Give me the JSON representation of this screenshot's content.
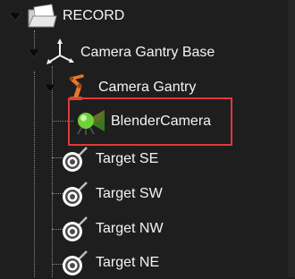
{
  "tree": {
    "nodes": [
      {
        "id": "record",
        "label": "RECORD",
        "icon": "folder-icon",
        "expanded": true
      },
      {
        "id": "camera-gantry-base",
        "label": "Camera Gantry Base",
        "icon": "axis-gizmo-icon",
        "expanded": true
      },
      {
        "id": "camera-gantry",
        "label": "Camera Gantry",
        "icon": "robot-arm-icon",
        "expanded": true
      },
      {
        "id": "blender-camera",
        "label": "BlenderCamera",
        "icon": "camera-icon",
        "selected": true
      },
      {
        "id": "target-se",
        "label": "Target SE",
        "icon": "target-icon"
      },
      {
        "id": "target-sw",
        "label": "Target SW",
        "icon": "target-icon"
      },
      {
        "id": "target-nw",
        "label": "Target NW",
        "icon": "target-icon"
      },
      {
        "id": "target-ne",
        "label": "Target NE",
        "icon": "target-icon"
      }
    ]
  },
  "colors": {
    "background": "#1e1e1e",
    "text": "#f4f4f4",
    "highlight_border": "#e0383b",
    "gantry_orange": "#e8762a",
    "camera_green": "#6fd13a"
  }
}
